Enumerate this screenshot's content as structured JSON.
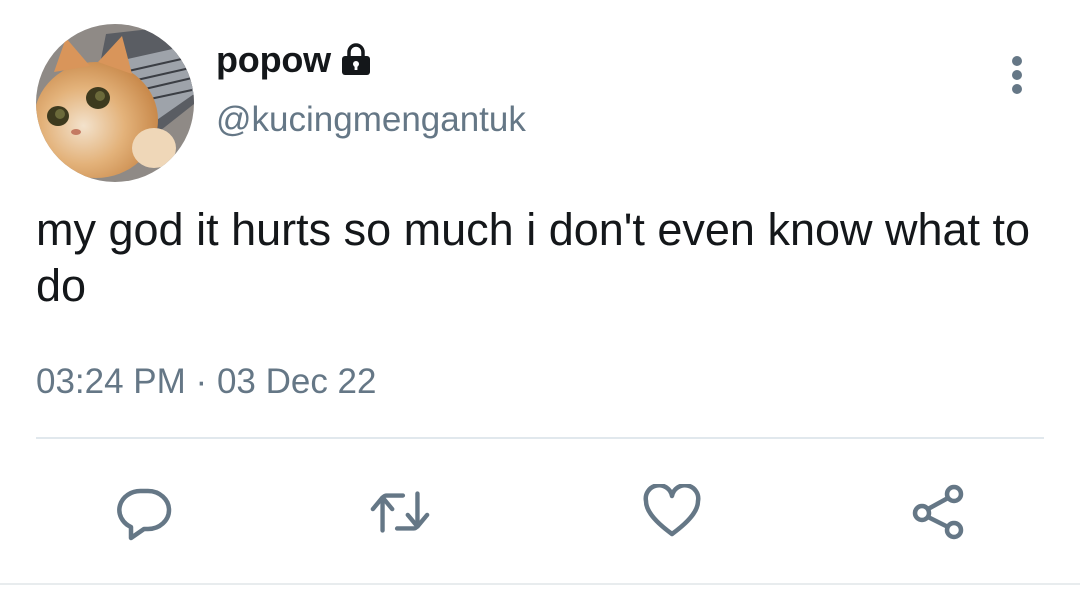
{
  "author": {
    "display_name": "popow",
    "handle": "@kucingmengantuk",
    "protected": true,
    "avatar_icon": "cat-avatar"
  },
  "tweet": {
    "text": "my god it hurts so much i don't even know what to do",
    "time": "03:24 PM",
    "separator": "·",
    "date": "03 Dec 22"
  },
  "icons": {
    "lock": "lock-icon",
    "more": "more-vertical-icon",
    "reply": "reply-icon",
    "retweet": "retweet-icon",
    "like": "heart-icon",
    "share": "share-icon"
  },
  "colors": {
    "primary_text": "#14171a",
    "secondary_text": "#657786",
    "divider": "#e1e8ed"
  }
}
